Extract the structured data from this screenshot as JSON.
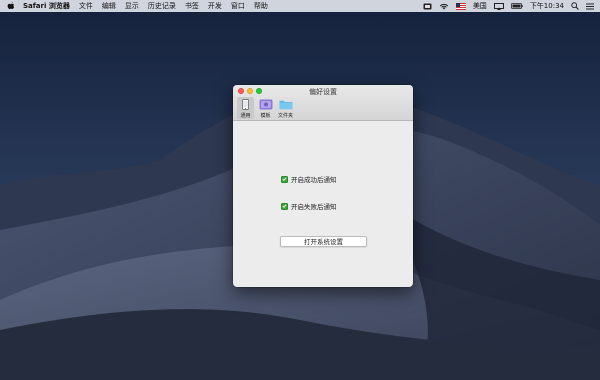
{
  "menubar": {
    "app_name": "Safari 浏览器",
    "items": [
      "文件",
      "编辑",
      "显示",
      "历史记录",
      "书签",
      "开发",
      "窗口",
      "帮助"
    ],
    "input_source": "美国",
    "clock": "下午10:34",
    "icons": [
      "apple-icon",
      "display-icon",
      "wifi-icon",
      "flag-icon",
      "airplay-icon",
      "battery-icon",
      "search-icon",
      "list-icon"
    ]
  },
  "window": {
    "title": "偏好设置",
    "toolbar": [
      {
        "label": "通用",
        "icon": "phone-icon"
      },
      {
        "label": "模板",
        "icon": "template-icon"
      },
      {
        "label": "文件夹",
        "icon": "folder-icon"
      }
    ],
    "options": [
      {
        "label": "开启成功后通知",
        "checked": true
      },
      {
        "label": "开启失败后通知",
        "checked": true
      }
    ],
    "open_settings_button": "打开系统设置"
  },
  "colors": {
    "checkbox": "#3fa83a",
    "close": "#ff5f57",
    "minimize": "#febc2e",
    "maximize": "#28c840"
  }
}
